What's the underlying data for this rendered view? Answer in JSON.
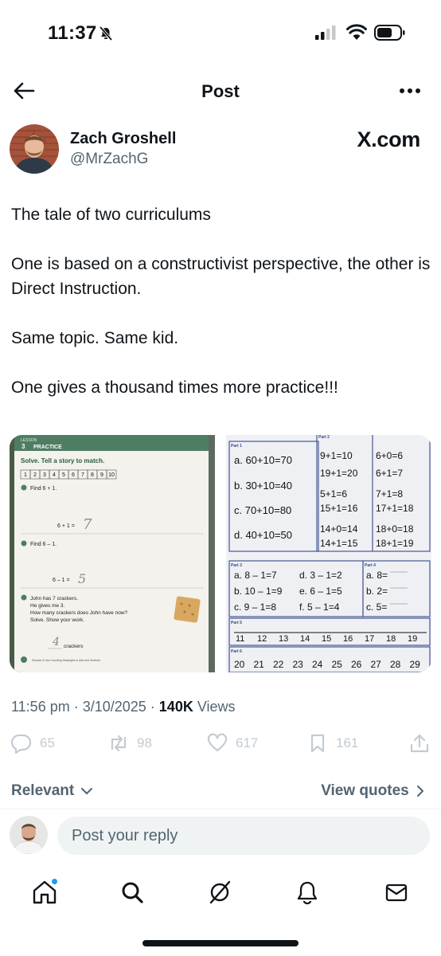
{
  "status_bar": {
    "time": "11:37"
  },
  "header": {
    "title": "Post"
  },
  "author": {
    "name": "Zach Groshell",
    "handle": "@MrZachG",
    "source_badge": "X.com"
  },
  "post": {
    "paragraphs": [
      "The tale of two curriculums",
      "One is based on a constructivist perspective, the other is Direct Instruction.",
      "Same topic. Same kid.",
      "One gives a thousand times more practice!!!"
    ]
  },
  "worksheet_left": {
    "lesson_label": "LESSON",
    "lesson_number": "3",
    "section": "PRACTICE",
    "instruction": "Solve. Tell a story to match.",
    "number_line": [
      "1",
      "2",
      "3",
      "4",
      "5",
      "6",
      "7",
      "8",
      "9",
      "10"
    ],
    "q3": "Find 6 + 1.",
    "q3_equation": "6 + 1 =",
    "q3_answer": "7",
    "q4": "Find 6 – 1.",
    "q4_equation": "6 – 1 =",
    "q4_answer": "5",
    "q5_lines": [
      "John has 7 crackers.",
      "He gives me 3.",
      "How many crackers does John have now?",
      "Solve. Show your work."
    ],
    "q5_answer": "4",
    "q5_unit": "crackers",
    "footer": "Session 3 Use Counting Strategies to Add and Subtract"
  },
  "worksheet_right": {
    "part1_label": "Part 1",
    "part1": [
      "a. 60+10=70",
      "b. 30+10=40",
      "c. 70+10=80",
      "d. 40+10=50"
    ],
    "part2_label": "Part 2",
    "part2": [
      "9+1=10",
      "6+0=6",
      "19+1=20",
      "6+1=7",
      "5+1=6",
      "7+1=8",
      "15+1=16",
      "17+1=18",
      "14+0=14",
      "18+0=18",
      "14+1=15",
      "18+1=19"
    ],
    "part3_label": "Part 3",
    "part3": [
      "a. 8 – 1=7",
      "d. 3 – 1=2",
      "b. 10 – 1=9",
      "e. 6 – 1=5",
      "c. 9 – 1=8",
      "f. 5 – 1=4"
    ],
    "part4_label": "Part 4",
    "part4": [
      "a. 8=",
      "b. 2=",
      "c. 5="
    ],
    "part5_label": "Part 5",
    "part5": [
      "11",
      "12",
      "13",
      "14",
      "15",
      "16",
      "17",
      "18",
      "19"
    ],
    "part6_label": "Part 6",
    "part6": [
      "20",
      "21",
      "22",
      "23",
      "24",
      "25",
      "26",
      "27",
      "28",
      "29"
    ]
  },
  "meta": {
    "time": "11:56 pm",
    "date": "3/10/2025",
    "views_count": "140K",
    "views_label": "Views"
  },
  "actions": {
    "replies": "65",
    "reposts": "98",
    "likes": "617",
    "bookmarks": "161"
  },
  "replies_header": {
    "sort_label": "Relevant",
    "view_quotes_label": "View quotes"
  },
  "reply_box": {
    "placeholder": "Post your reply"
  },
  "colors": {
    "text_primary": "#0f1419",
    "text_secondary": "#536471",
    "action_gray": "#c3cbd3",
    "accent": "#1d9bf0",
    "worksheet_green": "#4e7d63"
  }
}
